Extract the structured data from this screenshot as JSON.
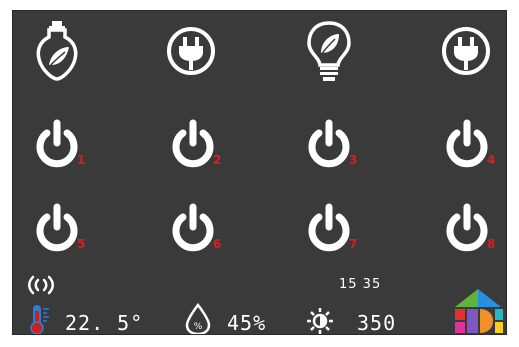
{
  "top_row": [
    {
      "icon": "eco-bulb-icon"
    },
    {
      "icon": "plug-icon"
    },
    {
      "icon": "leaf-bulb-icon"
    },
    {
      "icon": "plug-icon"
    }
  ],
  "power_buttons": [
    {
      "label": "1"
    },
    {
      "label": "2"
    },
    {
      "label": "3"
    },
    {
      "label": "4"
    },
    {
      "label": "5"
    },
    {
      "label": "6"
    },
    {
      "label": "7"
    },
    {
      "label": "8"
    }
  ],
  "status": {
    "wireless_icon": "wireless-signal-icon",
    "time": "15 35",
    "temperature": "22. 5°",
    "humidity": "45%",
    "light": "350"
  },
  "colors": {
    "background": "#3a3a3a",
    "foreground": "#ffffff",
    "label_red": "#d62020",
    "thermometer_blue": "#2a7fd4",
    "thermometer_red": "#d02020",
    "logo_green": "#5fb33a",
    "logo_blue": "#2a8fe0",
    "logo_red": "#e53030",
    "logo_magenta": "#e0309a",
    "logo_purple": "#7e57c2",
    "logo_orange": "#f0902a",
    "logo_teal": "#23b8c4",
    "logo_yellow": "#f5d020"
  }
}
